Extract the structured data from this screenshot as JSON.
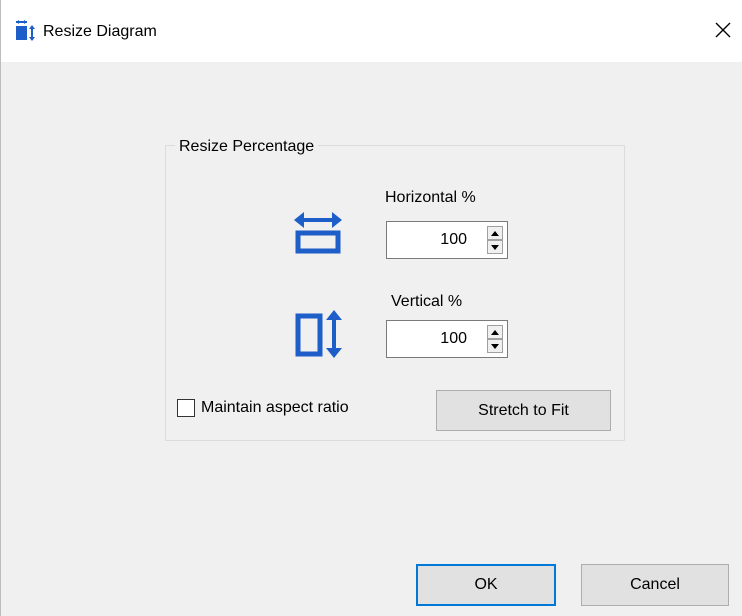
{
  "window": {
    "title": "Resize Diagram",
    "close_glyph": "✕"
  },
  "group": {
    "label": "Resize Percentage"
  },
  "horizontal": {
    "label": "Horizontal %",
    "value": "100",
    "icon": "horizontal-resize-icon"
  },
  "vertical": {
    "label": "Vertical %",
    "value": "100",
    "icon": "vertical-resize-icon"
  },
  "aspect": {
    "label": "Maintain aspect ratio",
    "checked": false
  },
  "buttons": {
    "stretch": "Stretch to Fit",
    "ok": "OK",
    "cancel": "Cancel"
  },
  "colors": {
    "accent": "#1e5ec9",
    "focus_border": "#0078d7",
    "dialog_bg": "#f0f0f0",
    "button_bg": "#e1e1e1"
  }
}
